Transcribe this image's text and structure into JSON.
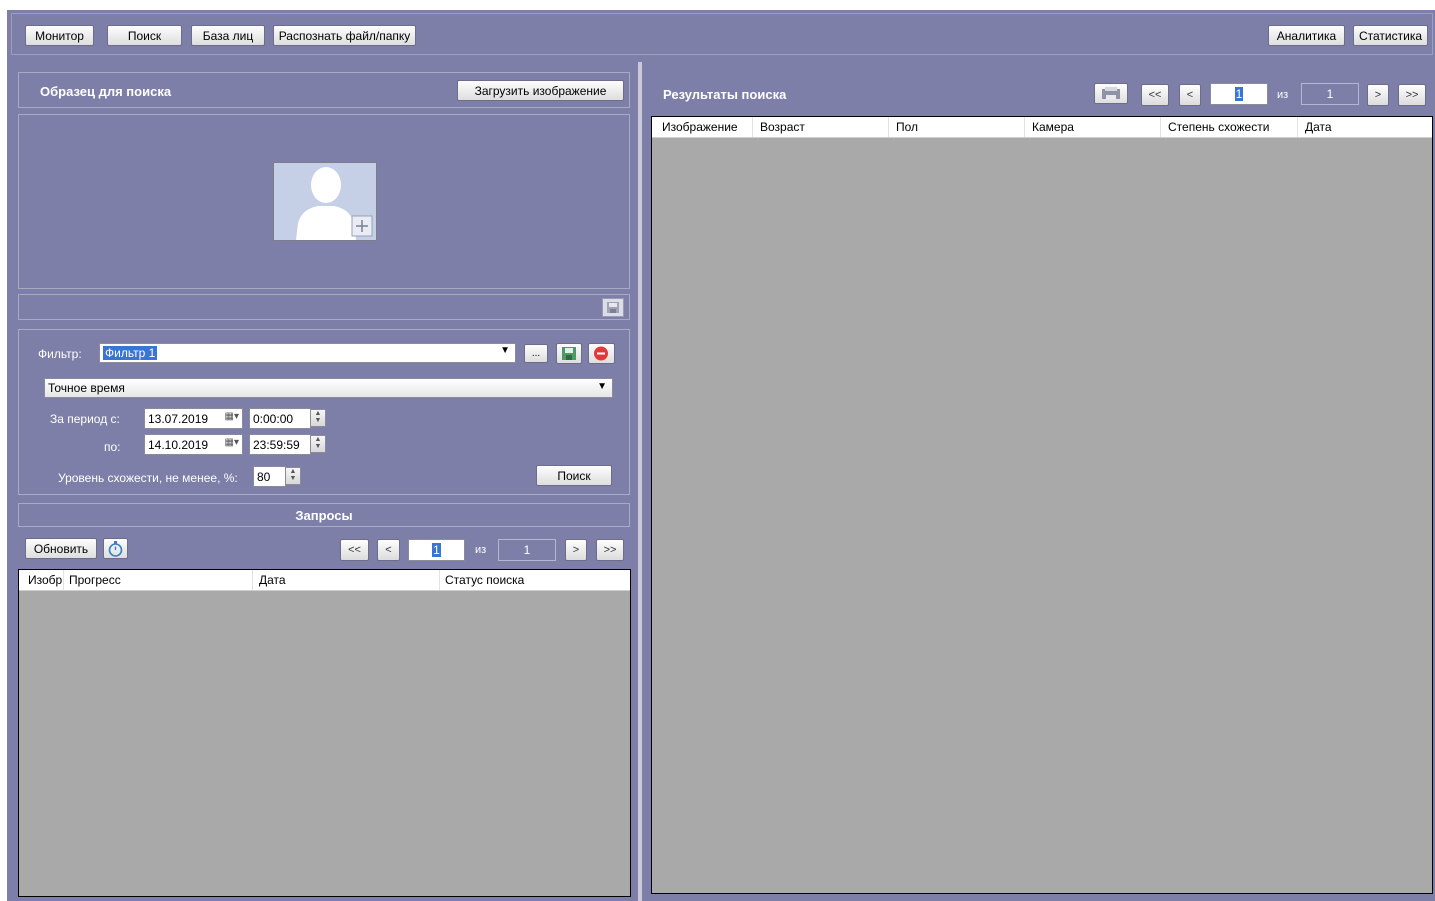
{
  "toolbar": {
    "monitor": "Монитор",
    "search": "Поиск",
    "face_db": "База лиц",
    "recognize": "Распознать файл/папку",
    "analytics": "Аналитика",
    "statistics": "Статистика"
  },
  "sample": {
    "title": "Образец для поиска",
    "upload_label": "Загрузить изображение"
  },
  "filter": {
    "label": "Фильтр:",
    "value": "Фильтр 1",
    "more_label": "...",
    "time_mode": "Точное время",
    "period_from_label": "За период с:",
    "period_to_label": "по:",
    "date_from": "13.07.2019",
    "time_from": "0:00:00",
    "date_to": "14.10.2019",
    "time_to": "23:59:59",
    "similarity_label": "Уровень схожести, не менее, %:",
    "similarity_value": "80",
    "search_button": "Поиск"
  },
  "requests": {
    "title": "Запросы",
    "refresh_label": "Обновить",
    "nav": {
      "first": "<<",
      "prev": "<",
      "page": "1",
      "of": "из",
      "total": "1",
      "next": ">",
      "last": ">>"
    },
    "columns": [
      "Изобр",
      "Прогресс",
      "Дата",
      "Статус поиска"
    ]
  },
  "results": {
    "title": "Результаты поиска",
    "nav": {
      "first": "<<",
      "prev": "<",
      "page": "1",
      "of": "из",
      "total": "1",
      "next": ">",
      "last": ">>"
    },
    "columns": [
      "Изображение",
      "Возраст",
      "Пол",
      "Камера",
      "Степень схожести",
      "Дата"
    ]
  },
  "icons": {
    "avatar": "avatar-placeholder-icon",
    "save": "save-icon",
    "delete": "remove-icon",
    "timer": "stopwatch-icon",
    "calendar": "calendar-icon",
    "export": "print-export-icon"
  }
}
